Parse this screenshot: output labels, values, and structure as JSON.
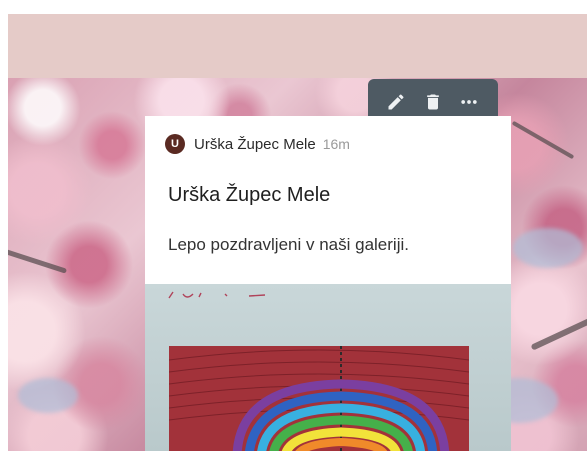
{
  "toolbar": {
    "edit_icon": "pencil-icon",
    "delete_icon": "trash-icon",
    "more_icon": "more-horizontal-icon"
  },
  "post": {
    "author": {
      "avatar_initial": "U",
      "name": "Urška Župec Mele",
      "time": "16m"
    },
    "title": "Urška Župec Mele",
    "body": "Lepo pozdravljeni v naši galeriji."
  },
  "colors": {
    "header_band": "#e5cbc8",
    "toolbar_bg": "#4e5a63",
    "avatar_bg": "#5a2a22"
  }
}
